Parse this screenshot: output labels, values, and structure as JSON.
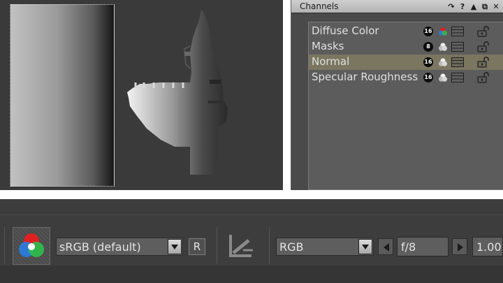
{
  "channels_panel": {
    "title": "Channels",
    "tools": [
      "rotate-icon",
      "help-icon",
      "collapse-icon",
      "float-icon",
      "close-icon"
    ],
    "items": [
      {
        "label": "Diffuse Color",
        "bit_depth": "16",
        "color_icon": "rgb-icon",
        "selected": false
      },
      {
        "label": "Masks",
        "bit_depth": "8",
        "color_icon": "gray-icon",
        "selected": false
      },
      {
        "label": "Normal",
        "bit_depth": "16",
        "color_icon": "gray-icon",
        "selected": true
      },
      {
        "label": "Specular Roughness",
        "bit_depth": "16",
        "color_icon": "gray-icon",
        "selected": false
      }
    ]
  },
  "toolbar": {
    "colorspace_value": "sRGB (default)",
    "reset_label": "R",
    "channel_mode_value": "RGB",
    "fstop_value": "f/8",
    "gamma_value": "1.00"
  },
  "colors": {
    "viewport_bg": "#3a3a3a",
    "panel_bg": "#4a4a4a",
    "selected_row": "#7a7660",
    "toolbar_bg": "#3d3d3d"
  }
}
